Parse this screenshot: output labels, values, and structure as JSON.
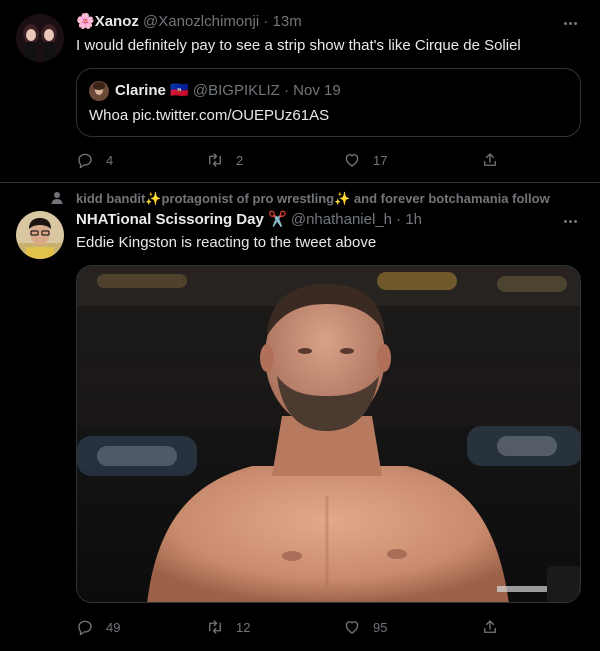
{
  "tweets": [
    {
      "display_name": "Xanoz",
      "name_emoji": "🌸",
      "handle": "@Xanozlchimonji",
      "dot": "·",
      "time": "13m",
      "text": "I would definitely pay to see a strip show that's like Cirque de Soliel",
      "quote": {
        "display_name": "Clarine",
        "flag": "🇭🇹",
        "handle": "@BIGPIKLIZ",
        "dot": "·",
        "time": "Nov 19",
        "text": "Whoa pic.twitter.com/OUEPUz61AS"
      },
      "actions": {
        "replies": "4",
        "retweets": "2",
        "likes": "17"
      }
    },
    {
      "social_context": "kidd bandit✨protagonist of pro wrestling✨ and forever botchamania follow",
      "display_name": "NHATional Scissoring Day",
      "name_emoji": "✂️",
      "handle": "@nhathaniel_h",
      "dot": "·",
      "time": "1h",
      "text": "Eddie Kingston is reacting to the tweet above",
      "actions": {
        "replies": "49",
        "retweets": "12",
        "likes": "95"
      }
    }
  ],
  "icons": {
    "more": "more-icon",
    "reply": "reply-icon",
    "retweet": "retweet-icon",
    "like": "like-icon",
    "share": "share-icon",
    "follow": "person-icon"
  },
  "colors": {
    "background": "#000000",
    "text": "#e7e9ea",
    "muted": "#71767b",
    "border": "#2f3336"
  }
}
